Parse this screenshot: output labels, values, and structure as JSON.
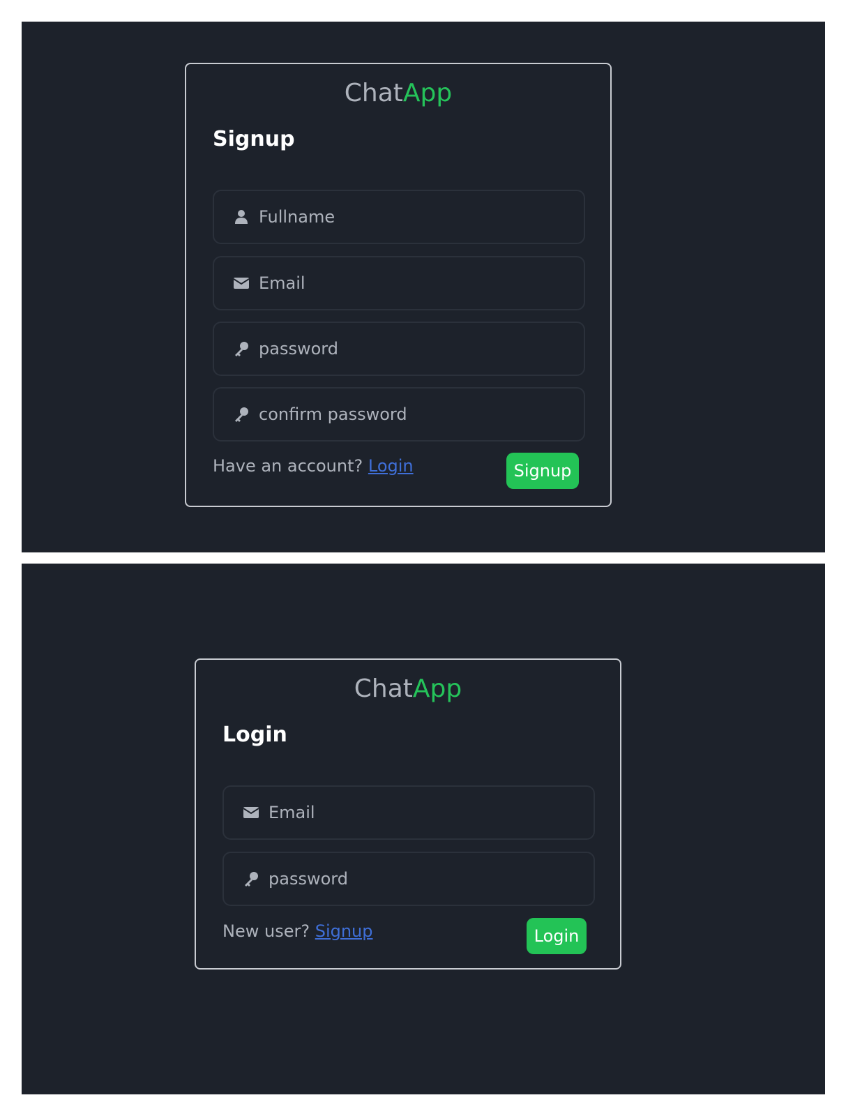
{
  "brand": {
    "name_part1": "Chat",
    "name_part2": "App",
    "name_part1_color": "#aeb3bc",
    "name_part2_color": "#25c35a"
  },
  "signup": {
    "title": "Signup",
    "fields": {
      "fullname": {
        "placeholder": "Fullname",
        "icon": "user-icon"
      },
      "email": {
        "placeholder": "Email",
        "icon": "envelope-icon"
      },
      "password": {
        "placeholder": "password",
        "icon": "key-icon"
      },
      "confirm_password": {
        "placeholder": "confirm password",
        "icon": "key-icon"
      }
    },
    "footer_prompt": "Have an account? ",
    "footer_link": "Login",
    "submit_label": "Signup"
  },
  "login": {
    "title": "Login",
    "fields": {
      "email": {
        "placeholder": "Email",
        "icon": "envelope-icon"
      },
      "password": {
        "placeholder": "password",
        "icon": "key-icon"
      }
    },
    "footer_prompt": "New user? ",
    "footer_link": "Signup",
    "submit_label": "Login"
  },
  "colors": {
    "background": "#1d222b",
    "card_border": "#c9ccd2",
    "accent_green": "#23c356",
    "link_blue": "#3f6fd8"
  }
}
